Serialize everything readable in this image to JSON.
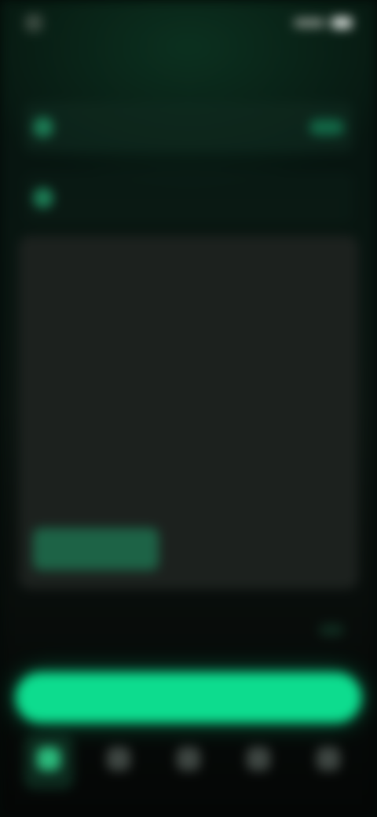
{
  "status": {
    "time": "",
    "brand_icon": "app-logo-icon",
    "signal_icon": "signal-icon",
    "battery_icon": "battery-icon"
  },
  "header": {
    "title": ""
  },
  "rows": [
    {
      "icon": "wallet-icon",
      "label": "",
      "value": ""
    },
    {
      "icon": "gift-icon",
      "label": "",
      "value": ""
    }
  ],
  "card": {
    "text": "",
    "cta_label": ""
  },
  "field": {
    "label": "",
    "value": ""
  },
  "primary_button": {
    "label": ""
  },
  "tabs": [
    {
      "icon": "home-icon",
      "label": "",
      "active": true
    },
    {
      "icon": "chart-icon",
      "label": "",
      "active": false
    },
    {
      "icon": "swap-icon",
      "label": "",
      "active": false
    },
    {
      "icon": "list-icon",
      "label": "",
      "active": false
    },
    {
      "icon": "profile-icon",
      "label": "",
      "active": false
    }
  ],
  "colors": {
    "accent": "#0ddc8e",
    "accent_dark": "#126846",
    "background": "#06160f",
    "card": "#1c211e"
  }
}
